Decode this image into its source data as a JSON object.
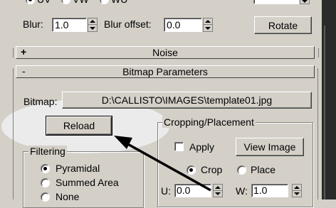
{
  "top_radios": [
    "UV",
    "VW",
    "WU"
  ],
  "blur": {
    "label": "Blur:",
    "value": "1.0"
  },
  "blur_offset": {
    "label": "Blur offset:",
    "value": "0.0"
  },
  "rotate_label": "Rotate",
  "noise_rollout": {
    "sign": "+",
    "title": "Noise"
  },
  "bitmap_rollout": {
    "sign": "-",
    "title": "Bitmap Parameters"
  },
  "bitmap": {
    "label": "Bitmap:",
    "path": "D:\\CALLISTO\\IMAGES\\template01.jpg"
  },
  "reload_label": "Reload",
  "cropping": {
    "title": "Cropping/Placement",
    "apply_label": "Apply",
    "view_image_label": "View Image",
    "crop_label": "Crop",
    "place_label": "Place",
    "mode": "Crop",
    "u_label": "U:",
    "u_value": "0.0",
    "w_label": "W:",
    "w_value": "1.0"
  },
  "filtering": {
    "title": "Filtering",
    "options": [
      "Pyramidal",
      "Summed Area",
      "None"
    ],
    "selected": "Pyramidal"
  },
  "colors": {
    "highlight": "#ebebeb",
    "arrow": "#000000",
    "panel": "#d4d0c8"
  }
}
